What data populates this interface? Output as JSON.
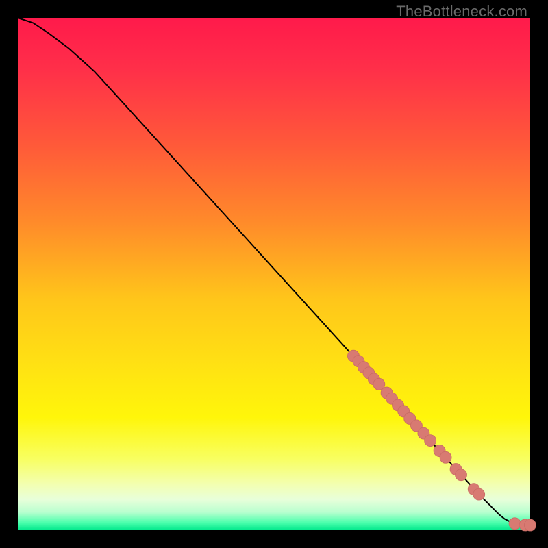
{
  "watermark": "TheBottleneck.com",
  "colors": {
    "gradient_stops": [
      {
        "offset": 0,
        "color": "#ff1a4b"
      },
      {
        "offset": 0.1,
        "color": "#ff2f49"
      },
      {
        "offset": 0.25,
        "color": "#ff5a39"
      },
      {
        "offset": 0.4,
        "color": "#ff8b2a"
      },
      {
        "offset": 0.55,
        "color": "#ffc61a"
      },
      {
        "offset": 0.68,
        "color": "#ffe213"
      },
      {
        "offset": 0.78,
        "color": "#fff60a"
      },
      {
        "offset": 0.86,
        "color": "#f8ff60"
      },
      {
        "offset": 0.91,
        "color": "#f3ffb0"
      },
      {
        "offset": 0.94,
        "color": "#e8ffda"
      },
      {
        "offset": 0.965,
        "color": "#b8ffcf"
      },
      {
        "offset": 0.985,
        "color": "#4dffad"
      },
      {
        "offset": 1.0,
        "color": "#00e88b"
      }
    ],
    "curve": "#000000",
    "marker_fill": "#d87a72",
    "marker_stroke": "#c86b64"
  },
  "chart_data": {
    "type": "line",
    "title": "",
    "xlabel": "",
    "ylabel": "",
    "xlim": [
      0,
      100
    ],
    "ylim": [
      0,
      100
    ],
    "grid": false,
    "legend": false,
    "series": [
      {
        "name": "curve",
        "x": [
          0,
          3,
          6,
          10,
          15,
          20,
          25,
          30,
          35,
          40,
          45,
          50,
          55,
          60,
          65,
          70,
          75,
          80,
          85,
          90,
          92,
          94,
          95,
          96,
          97,
          98,
          100
        ],
        "y": [
          100,
          99,
          97,
          94,
          89.5,
          84,
          78.5,
          73,
          67.5,
          62,
          56.5,
          51,
          45.5,
          40,
          34.5,
          29,
          23.5,
          18,
          12.5,
          7,
          5,
          3,
          2.2,
          1.7,
          1.3,
          1.0,
          1.0
        ]
      }
    ],
    "markers": [
      {
        "x": 65.5,
        "y": 34.0
      },
      {
        "x": 66.5,
        "y": 33.0
      },
      {
        "x": 67.5,
        "y": 31.8
      },
      {
        "x": 68.5,
        "y": 30.7
      },
      {
        "x": 69.5,
        "y": 29.5
      },
      {
        "x": 70.5,
        "y": 28.5
      },
      {
        "x": 72.0,
        "y": 26.8
      },
      {
        "x": 73.0,
        "y": 25.7
      },
      {
        "x": 74.2,
        "y": 24.4
      },
      {
        "x": 75.3,
        "y": 23.2
      },
      {
        "x": 76.5,
        "y": 21.8
      },
      {
        "x": 77.8,
        "y": 20.4
      },
      {
        "x": 79.2,
        "y": 18.9
      },
      {
        "x": 80.5,
        "y": 17.5
      },
      {
        "x": 82.3,
        "y": 15.5
      },
      {
        "x": 83.5,
        "y": 14.2
      },
      {
        "x": 85.5,
        "y": 11.9
      },
      {
        "x": 86.5,
        "y": 10.8
      },
      {
        "x": 89.0,
        "y": 8.0
      },
      {
        "x": 90.0,
        "y": 7.0
      },
      {
        "x": 97.0,
        "y": 1.3
      },
      {
        "x": 99.0,
        "y": 1.0
      },
      {
        "x": 100.0,
        "y": 1.0
      }
    ]
  }
}
